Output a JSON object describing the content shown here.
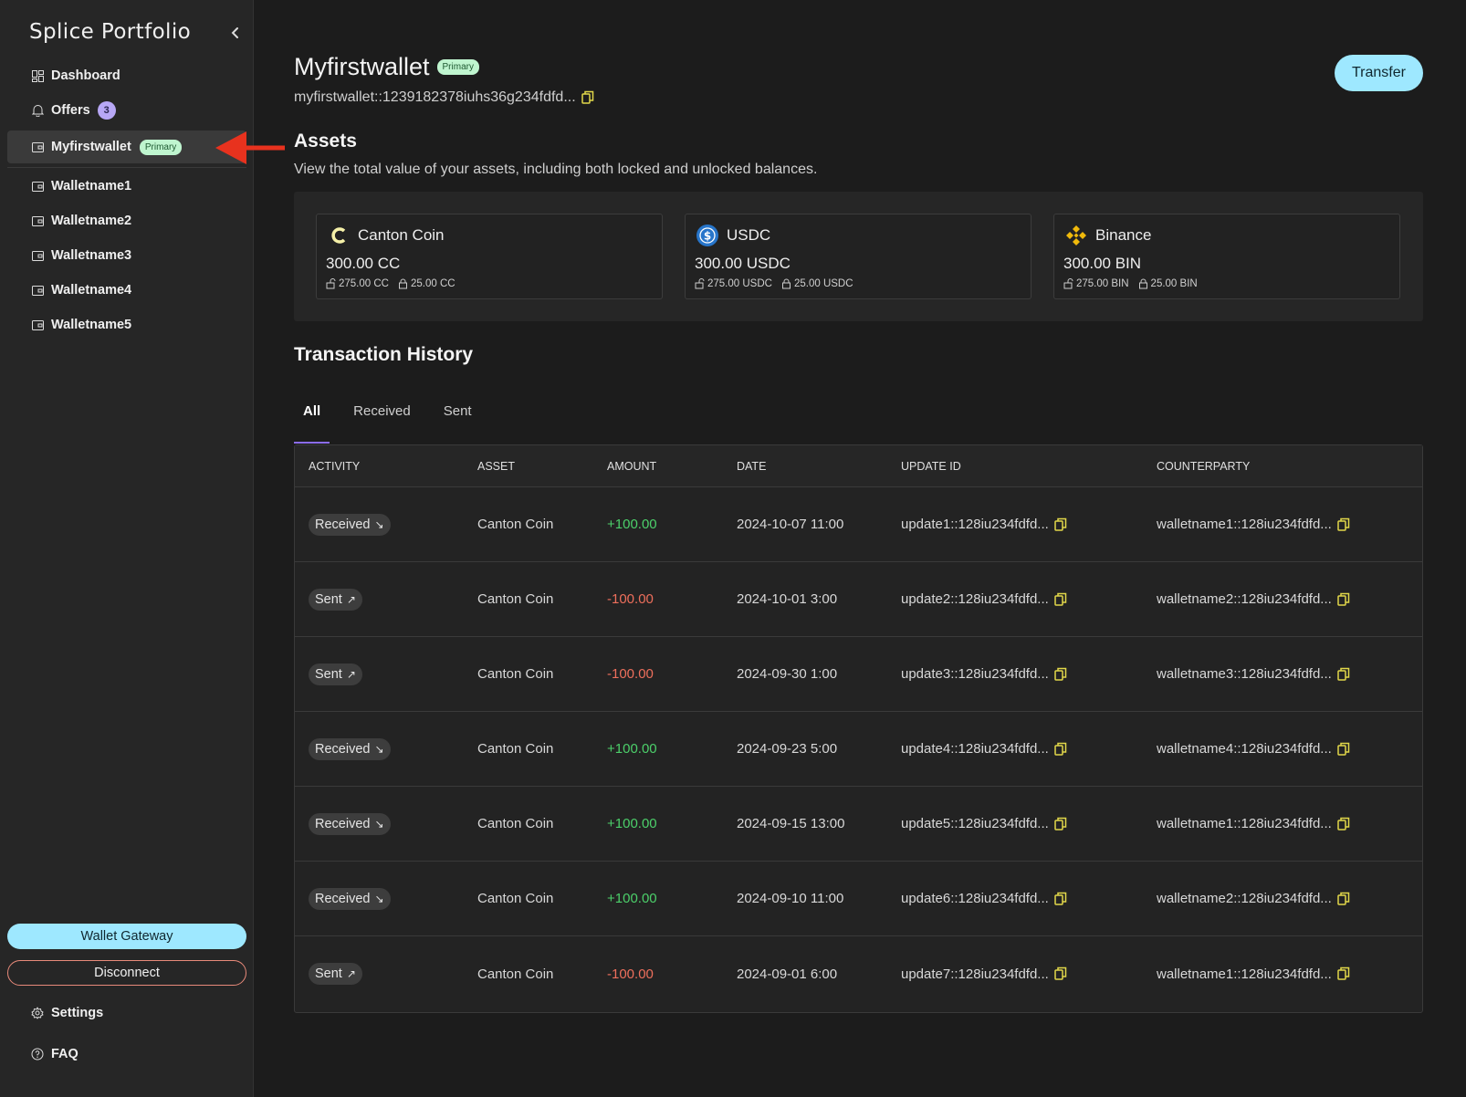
{
  "sidebar": {
    "brand": "Splice Portfolio",
    "nav": [
      {
        "label": "Dashboard"
      },
      {
        "label": "Offers",
        "badge": "3"
      },
      {
        "label": "Myfirstwallet",
        "pill": "Primary"
      }
    ],
    "wallets": [
      "Walletname1",
      "Walletname2",
      "Walletname3",
      "Walletname4",
      "Walletname5"
    ],
    "gateway_label": "Wallet Gateway",
    "disconnect_label": "Disconnect",
    "settings_label": "Settings",
    "faq_label": "FAQ"
  },
  "header": {
    "wallet_name": "Myfirstwallet",
    "primary_pill": "Primary",
    "address": "myfirstwallet::1239182378iuhs36g234fdfd...",
    "transfer_label": "Transfer"
  },
  "assets": {
    "title": "Assets",
    "subtitle": "View the total value of your assets, including both locked and unlocked balances.",
    "cards": [
      {
        "name": "Canton Coin",
        "total": "300.00 CC",
        "unlocked": "275.00 CC",
        "locked": "25.00 CC",
        "icon": "canton-coin-icon"
      },
      {
        "name": "USDC",
        "total": "300.00 USDC",
        "unlocked": "275.00 USDC",
        "locked": "25.00 USDC",
        "icon": "usdc-icon"
      },
      {
        "name": "Binance",
        "total": "300.00 BIN",
        "unlocked": "275.00 BIN",
        "locked": "25.00 BIN",
        "icon": "binance-icon"
      }
    ]
  },
  "transactions": {
    "title": "Transaction History",
    "tabs": [
      "All",
      "Received",
      "Sent"
    ],
    "active_tab": "All",
    "columns": [
      "ACTIVITY",
      "ASSET",
      "AMOUNT",
      "DATE",
      "UPDATE ID",
      "COUNTERPARTY"
    ],
    "rows": [
      {
        "activity": "Received",
        "asset": "Canton Coin",
        "amount": "+100.00",
        "date": "2024-10-07 11:00",
        "update_id": "update1::128iu234fdfd...",
        "counterparty": "walletname1::128iu234fdfd..."
      },
      {
        "activity": "Sent",
        "asset": "Canton Coin",
        "amount": "-100.00",
        "date": "2024-10-01 3:00",
        "update_id": "update2::128iu234fdfd...",
        "counterparty": "walletname2::128iu234fdfd..."
      },
      {
        "activity": "Sent",
        "asset": "Canton Coin",
        "amount": "-100.00",
        "date": "2024-09-30 1:00",
        "update_id": "update3::128iu234fdfd...",
        "counterparty": "walletname3::128iu234fdfd..."
      },
      {
        "activity": "Received",
        "asset": "Canton Coin",
        "amount": "+100.00",
        "date": "2024-09-23 5:00",
        "update_id": "update4::128iu234fdfd...",
        "counterparty": "walletname4::128iu234fdfd..."
      },
      {
        "activity": "Received",
        "asset": "Canton Coin",
        "amount": "+100.00",
        "date": "2024-09-15 13:00",
        "update_id": "update5::128iu234fdfd...",
        "counterparty": "walletname1::128iu234fdfd..."
      },
      {
        "activity": "Received",
        "asset": "Canton Coin",
        "amount": "+100.00",
        "date": "2024-09-10 11:00",
        "update_id": "update6::128iu234fdfd...",
        "counterparty": "walletname2::128iu234fdfd..."
      },
      {
        "activity": "Sent",
        "asset": "Canton Coin",
        "amount": "-100.00",
        "date": "2024-09-01 6:00",
        "update_id": "update7::128iu234fdfd...",
        "counterparty": "walletname1::128iu234fdfd..."
      }
    ]
  },
  "colors": {
    "accent": "#9ee8ff",
    "primary_pill_bg": "#bff5cf",
    "positive": "#4ccf6a",
    "negative": "#ee6f5c",
    "tab_indicator": "#8b6cf0",
    "annotation_arrow": "#e8321e"
  }
}
